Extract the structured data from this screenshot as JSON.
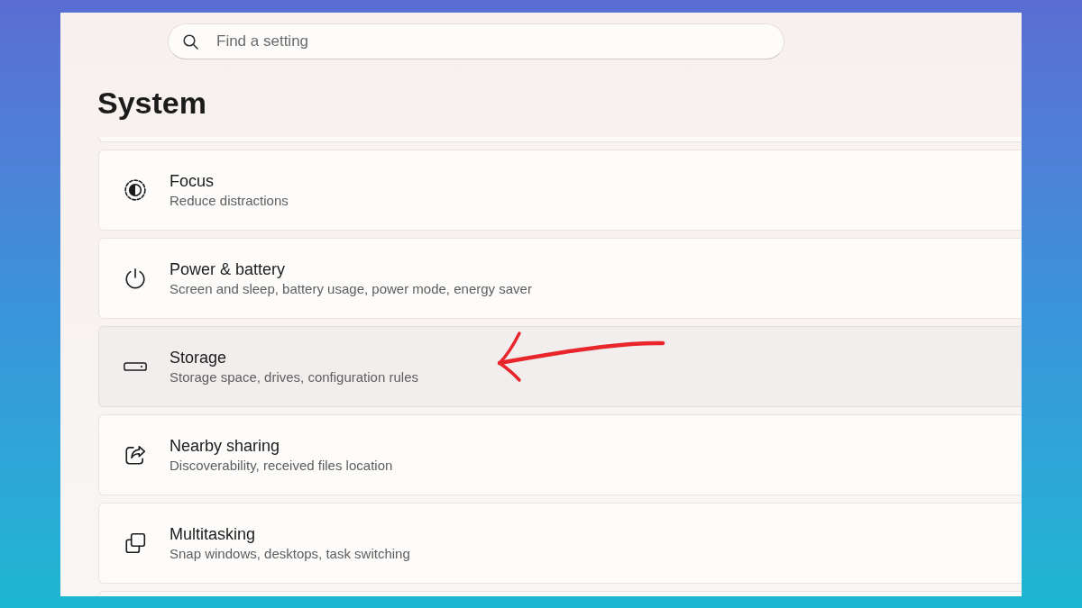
{
  "search": {
    "placeholder": "Find a setting"
  },
  "page": {
    "title": "System"
  },
  "settings": [
    {
      "kind": "focus",
      "title": "Focus",
      "description": "Reduce distractions",
      "hovered": false
    },
    {
      "kind": "power",
      "title": "Power & battery",
      "description": "Screen and sleep, battery usage, power mode, energy saver",
      "hovered": false
    },
    {
      "kind": "storage",
      "title": "Storage",
      "description": "Storage space, drives, configuration rules",
      "hovered": true
    },
    {
      "kind": "share",
      "title": "Nearby sharing",
      "description": "Discoverability, received files location",
      "hovered": false
    },
    {
      "kind": "multitasking",
      "title": "Multitasking",
      "description": "Snap windows, desktops, task switching",
      "hovered": false
    }
  ]
}
